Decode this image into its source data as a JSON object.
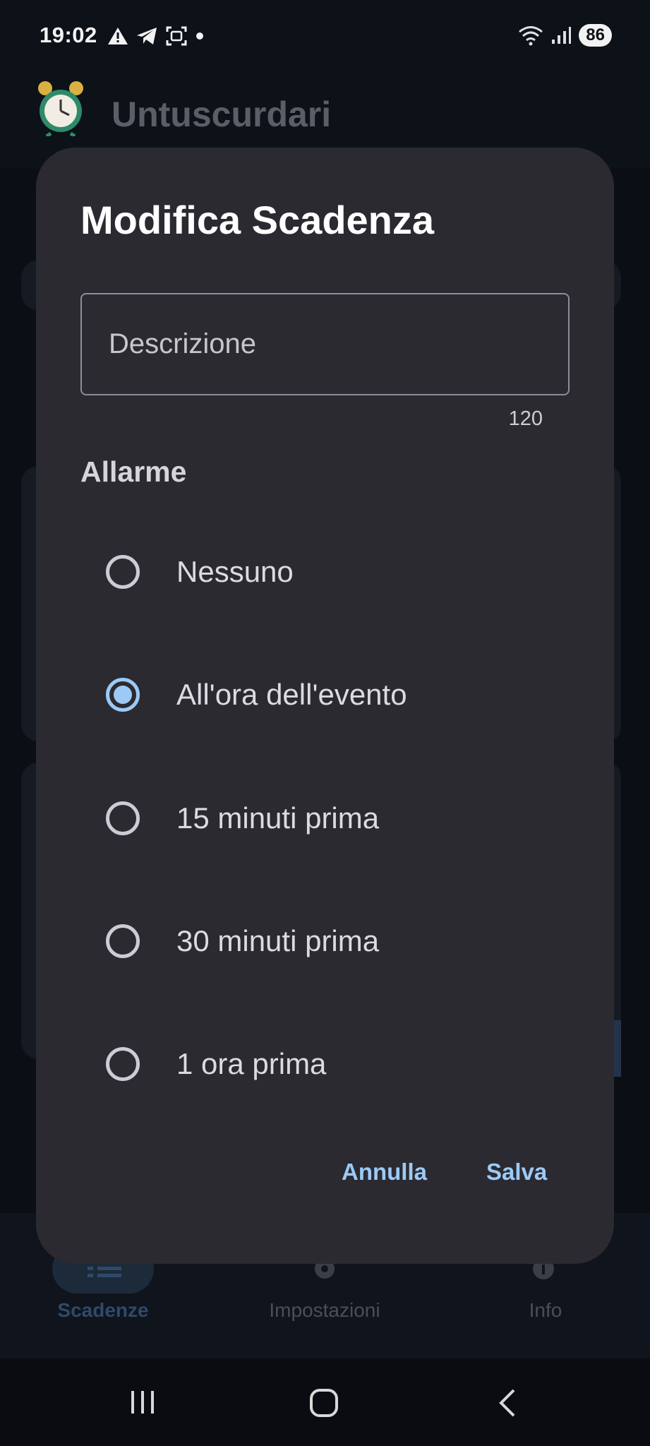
{
  "status_bar": {
    "time": "19:02",
    "battery": "86",
    "left_icons": [
      "warning-icon",
      "telegram-icon",
      "screenshot-icon",
      "dot-icon"
    ],
    "right_icons": [
      "wifi-icon",
      "signal-icon"
    ]
  },
  "app": {
    "title": "Untuscurdari",
    "logo": "alarm-clock-icon"
  },
  "bottom_nav": {
    "items": [
      {
        "label": "Scadenze",
        "icon": "list-icon",
        "active": true
      },
      {
        "label": "Impostazioni",
        "icon": "gear-icon",
        "active": false
      },
      {
        "label": "Info",
        "icon": "info-icon",
        "active": false
      }
    ]
  },
  "dialog": {
    "title": "Modifica Scadenza",
    "description_placeholder": "Descrizione",
    "description_value": "",
    "char_counter": "120",
    "alarm_section_label": "Allarme",
    "alarm_options": [
      {
        "label": "Nessuno",
        "selected": false
      },
      {
        "label": "All'ora dell'evento",
        "selected": true
      },
      {
        "label": "15 minuti prima",
        "selected": false
      },
      {
        "label": "30 minuti prima",
        "selected": false
      },
      {
        "label": "1 ora prima",
        "selected": false
      }
    ],
    "cancel_label": "Annulla",
    "save_label": "Salva"
  },
  "colors": {
    "accent": "#9ccaf5",
    "dialog_background": "#2b2a31",
    "app_background": "#0b0e15"
  }
}
